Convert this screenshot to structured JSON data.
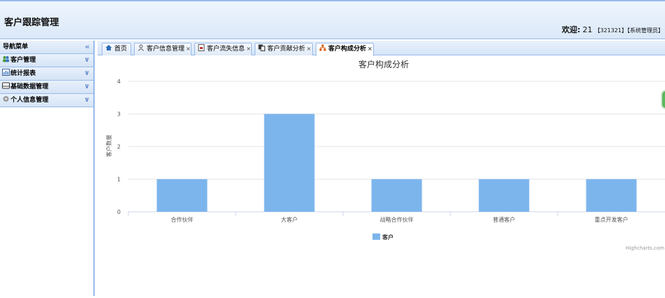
{
  "header": {
    "app_title": "客户跟踪管理",
    "welcome_label": "欢迎:",
    "user_number": "21",
    "user_code": "【321321】",
    "user_role": "【系统管理员】"
  },
  "sidebar": {
    "title": "导航菜单",
    "collapse_glyph": "«",
    "items": [
      {
        "label": "客户管理",
        "icon": "users-icon"
      },
      {
        "label": "统计报表",
        "icon": "chart-icon"
      },
      {
        "label": "基础数据管理",
        "icon": "database-icon"
      },
      {
        "label": "个人信息管理",
        "icon": "gear-icon"
      }
    ]
  },
  "tabs": [
    {
      "label": "首页",
      "icon": "home-icon",
      "closable": false
    },
    {
      "label": "客户信息管理",
      "icon": "person-icon",
      "closable": true
    },
    {
      "label": "客户流失信息",
      "icon": "document-icon",
      "closable": true
    },
    {
      "label": "客户贡献分析",
      "icon": "report-icon",
      "closable": true
    },
    {
      "label": "客户构成分析",
      "icon": "org-chart-icon",
      "closable": true,
      "active": true
    }
  ],
  "close_glyph": "×",
  "chart_data": {
    "type": "bar",
    "title": "客户构成分析",
    "ylabel": "客户数量",
    "xlabel": "",
    "categories": [
      "合作伙伴",
      "大客户",
      "战略合作伙伴",
      "普通客户",
      "重点开发客户"
    ],
    "series": [
      {
        "name": "客户",
        "values": [
          1,
          3,
          1,
          1,
          1
        ]
      }
    ],
    "ylim": [
      0,
      4
    ],
    "yticks": [
      0,
      1,
      2,
      3,
      4
    ],
    "grid": true,
    "legend": "bottom-center",
    "credits": "Highcharts.com",
    "colors": {
      "bar": "#7cb5ec"
    }
  }
}
